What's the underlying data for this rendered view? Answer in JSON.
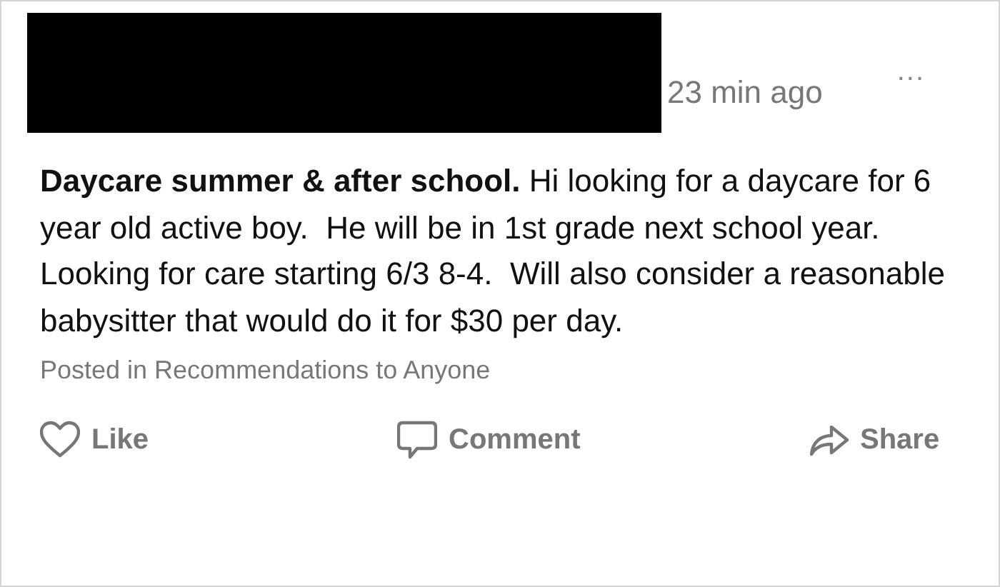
{
  "post": {
    "timestamp": "23 min ago",
    "more": "...",
    "body": "**Daycare summer & after school.** Hi looking for a daycare for 6 year old active boy.  He will be in 1st grade next school year.  Looking for care starting 6/3 8-4.  Will also consider a reasonable babysitter that would do it for $30 per day.",
    "posted_in": "Posted in Recommendations to Anyone"
  },
  "actions": [
    {
      "kind": "like",
      "label": "Like"
    },
    {
      "kind": "comment",
      "label": "Comment"
    },
    {
      "kind": "share",
      "label": "Share"
    }
  ]
}
